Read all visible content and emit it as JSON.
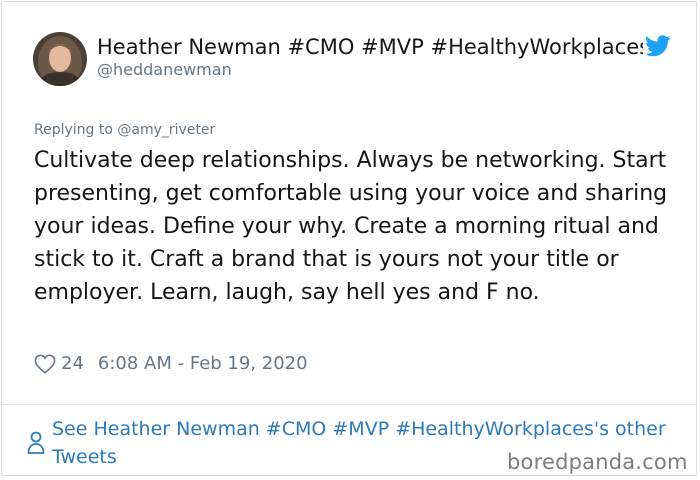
{
  "tweet": {
    "author": {
      "display_name": "Heather Newman #CMO #MVP #HealthyWorkplaces",
      "handle": "@heddanewman",
      "avatar_icon": "avatar-photo"
    },
    "replying_to": "Replying to @amy_riveter",
    "text": "Cultivate deep relationships. Always be networking. Start presenting, get comfortable using your voice and sharing your ideas. Define your why. Create a morning ritual and stick to it. Craft a brand that is yours not your title or employer. Learn, laugh, say hell yes and F no.",
    "likes": "24",
    "timestamp": "6:08 AM - Feb 19, 2020",
    "see_more": "See Heather Newman #CMO #MVP #HealthyWorkplaces's other Tweets"
  },
  "icons": {
    "brand": "twitter-bird-icon",
    "like": "heart-icon",
    "profile": "person-icon"
  },
  "colors": {
    "twitter_blue": "#1da1f2",
    "link_blue": "#2b7bb9",
    "muted_gray": "#657786",
    "text_dark": "#14171a"
  },
  "watermark": "boredpanda.com"
}
